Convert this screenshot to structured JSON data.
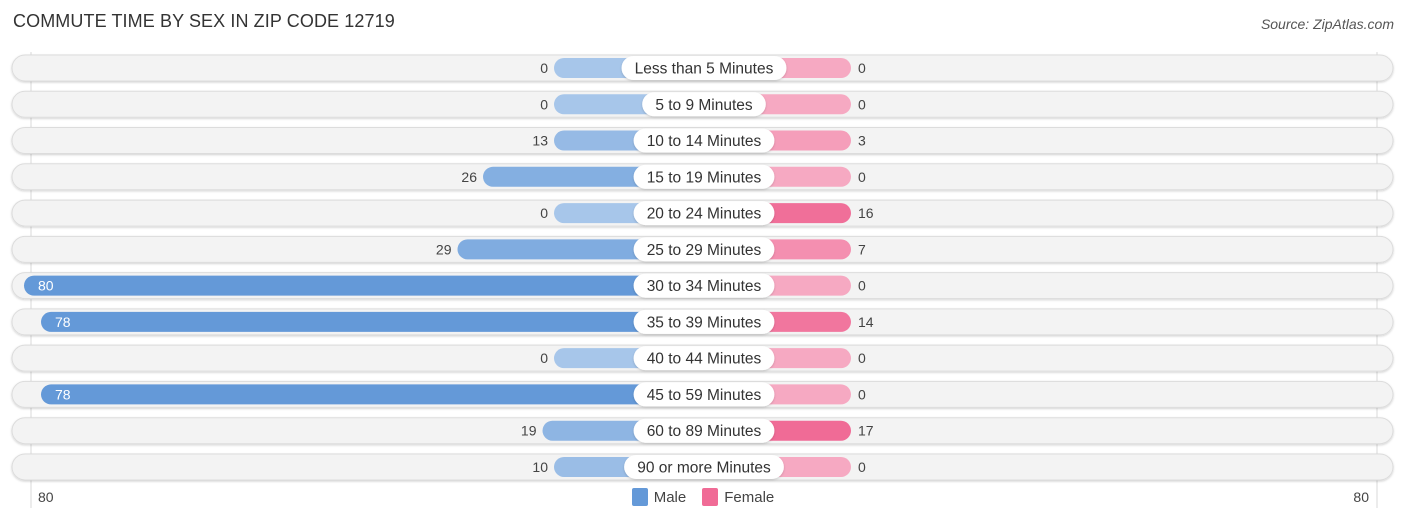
{
  "title": "COMMUTE TIME BY SEX IN ZIP CODE 12719",
  "source": "Source: ZipAtlas.com",
  "colors": {
    "male_strong": "#6499d8",
    "male_light": "#a7c6ea",
    "female_strong": "#f06b96",
    "female_light": "#f6a9c2",
    "row_bg": "#f3f3f3",
    "label_bg": "#ffffff"
  },
  "chart_data": {
    "type": "bar",
    "orientation": "horizontal-diverging",
    "title": "COMMUTE TIME BY SEX IN ZIP CODE 12719",
    "categories": [
      "Less than 5 Minutes",
      "5 to 9 Minutes",
      "10 to 14 Minutes",
      "15 to 19 Minutes",
      "20 to 24 Minutes",
      "25 to 29 Minutes",
      "30 to 34 Minutes",
      "35 to 39 Minutes",
      "40 to 44 Minutes",
      "45 to 59 Minutes",
      "60 to 89 Minutes",
      "90 or more Minutes"
    ],
    "series": [
      {
        "name": "Male",
        "side": "left",
        "values": [
          0,
          0,
          13,
          26,
          0,
          29,
          80,
          78,
          0,
          78,
          19,
          10
        ]
      },
      {
        "name": "Female",
        "side": "right",
        "values": [
          0,
          0,
          3,
          0,
          16,
          7,
          0,
          14,
          0,
          0,
          17,
          0
        ]
      }
    ],
    "axis": {
      "left_max_label": "80",
      "right_max_label": "80",
      "range": [
        80,
        80
      ]
    },
    "legend": {
      "position": "bottom-center",
      "entries": [
        "Male",
        "Female"
      ]
    },
    "grid": false
  },
  "legend": {
    "male_label": "Male",
    "female_label": "Female"
  },
  "axis_labels": {
    "left": "80",
    "right": "80"
  }
}
